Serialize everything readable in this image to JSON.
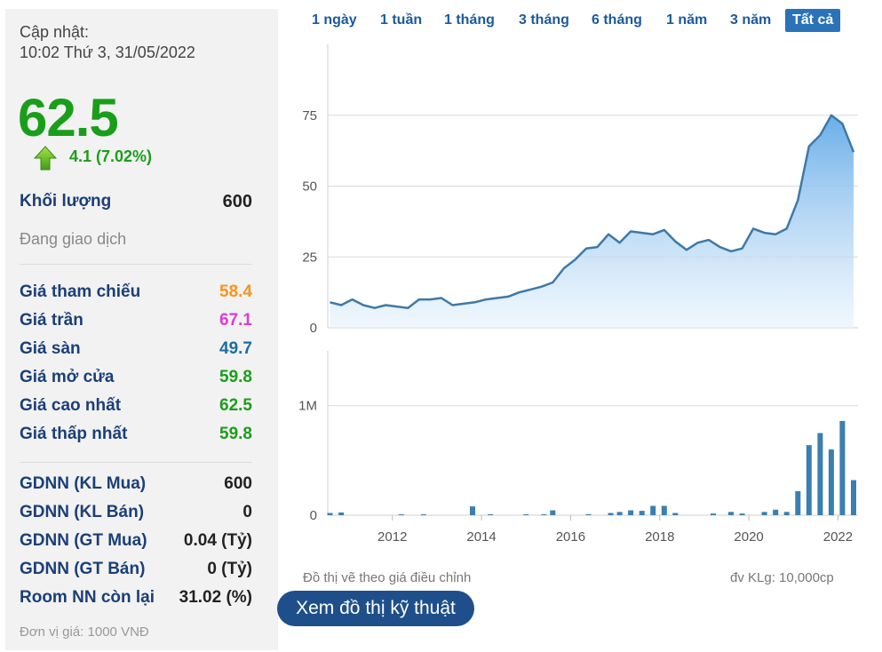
{
  "summary": {
    "update_label": "Cập nhật:",
    "update_time": "10:02 Thứ 3, 31/05/2022",
    "price": "62.5",
    "change": "4.1 (7.02%)",
    "volume_label": "Khối lượng",
    "volume_value": "600",
    "status": "Đang giao dịch",
    "unit_note": "Đơn vị giá: 1000 VNĐ"
  },
  "price_rows": [
    {
      "label": "Giá tham chiếu",
      "value": "58.4",
      "color": "#f7941d"
    },
    {
      "label": "Giá trần",
      "value": "67.1",
      "color": "#e03ad4"
    },
    {
      "label": "Giá sàn",
      "value": "49.7",
      "color": "#1c6ea4"
    },
    {
      "label": "Giá mở cửa",
      "value": "59.8",
      "color": "#1a9e1a"
    },
    {
      "label": "Giá cao nhất",
      "value": "62.5",
      "color": "#1a9e1a"
    },
    {
      "label": "Giá thấp nhất",
      "value": "59.8",
      "color": "#1a9e1a"
    }
  ],
  "foreign_rows": [
    {
      "label": "GDNN (KL Mua)",
      "value": "600"
    },
    {
      "label": "GDNN (KL Bán)",
      "value": "0"
    },
    {
      "label": "GDNN (GT Mua)",
      "value": "0.04 (Tỷ)"
    },
    {
      "label": "GDNN (GT Bán)",
      "value": "0 (Tỷ)"
    },
    {
      "label": "Room NN còn lại",
      "value": "31.02 (%)"
    }
  ],
  "ranges": {
    "tabs": [
      "1 ngày",
      "1 tuần",
      "1 tháng",
      "3 tháng",
      "6 tháng",
      "1 năm",
      "3 năm",
      "Tất cả"
    ],
    "active": "Tất cả"
  },
  "notes": {
    "adjusted": "Đồ thị vẽ theo giá điều chỉnh",
    "volume_unit": "đv KLg: 10,000cp"
  },
  "tech_button": "Xem đồ thị kỹ thuật",
  "chart_data": {
    "type": "area",
    "price": {
      "x": [
        2010.6,
        2010.85,
        2011.1,
        2011.35,
        2011.6,
        2011.85,
        2012.1,
        2012.35,
        2012.6,
        2012.85,
        2013.1,
        2013.35,
        2013.6,
        2013.85,
        2014.1,
        2014.35,
        2014.6,
        2014.85,
        2015.1,
        2015.35,
        2015.6,
        2015.85,
        2016.1,
        2016.35,
        2016.6,
        2016.85,
        2017.1,
        2017.35,
        2017.6,
        2017.85,
        2018.1,
        2018.35,
        2018.6,
        2018.85,
        2019.1,
        2019.35,
        2019.6,
        2019.85,
        2020.1,
        2020.35,
        2020.6,
        2020.85,
        2021.1,
        2021.35,
        2021.6,
        2021.85,
        2022.1,
        2022.35
      ],
      "y": [
        9,
        8,
        10,
        8,
        7,
        8,
        7.5,
        7,
        10,
        10,
        10.5,
        8,
        8.5,
        9,
        10,
        10.5,
        11,
        12.5,
        13.5,
        14.5,
        16,
        21,
        24,
        28,
        28.5,
        33,
        30,
        34,
        33.5,
        33,
        34.5,
        30.5,
        27.5,
        30,
        31,
        28.5,
        27,
        28,
        35,
        33.5,
        33,
        35,
        45,
        64,
        68,
        75,
        72,
        62
      ],
      "ylim": [
        0,
        100
      ],
      "yticks": [
        "0",
        "25",
        "50",
        "75"
      ]
    },
    "volume": {
      "x": [
        2010.6,
        2010.85,
        2012.2,
        2012.7,
        2013.8,
        2014.2,
        2015.0,
        2015.4,
        2015.6,
        2016.4,
        2016.9,
        2017.1,
        2017.35,
        2017.6,
        2017.85,
        2018.1,
        2018.35,
        2019.2,
        2019.6,
        2019.85,
        2020.35,
        2020.6,
        2020.85,
        2021.1,
        2021.35,
        2021.6,
        2021.85,
        2022.1,
        2022.35
      ],
      "y": [
        0.02,
        0.025,
        0.008,
        0.008,
        0.08,
        0.008,
        0.008,
        0.008,
        0.045,
        0.01,
        0.02,
        0.03,
        0.045,
        0.04,
        0.085,
        0.085,
        0.02,
        0.015,
        0.03,
        0.015,
        0.03,
        0.05,
        0.03,
        0.22,
        0.64,
        0.75,
        0.6,
        0.86,
        0.32
      ],
      "ylim": [
        0,
        1.5
      ],
      "yticks": [
        "0",
        "1M"
      ]
    },
    "xticks": [
      "2012",
      "2014",
      "2016",
      "2018",
      "2020",
      "2022"
    ],
    "xlim": [
      2010.55,
      2022.45
    ],
    "colors": {
      "line": "#3e79a8",
      "fill_top": "#6aaee8",
      "fill_bottom": "#e6f2fc",
      "bar": "#3a7fb0",
      "grid": "#d9d9d9"
    }
  }
}
